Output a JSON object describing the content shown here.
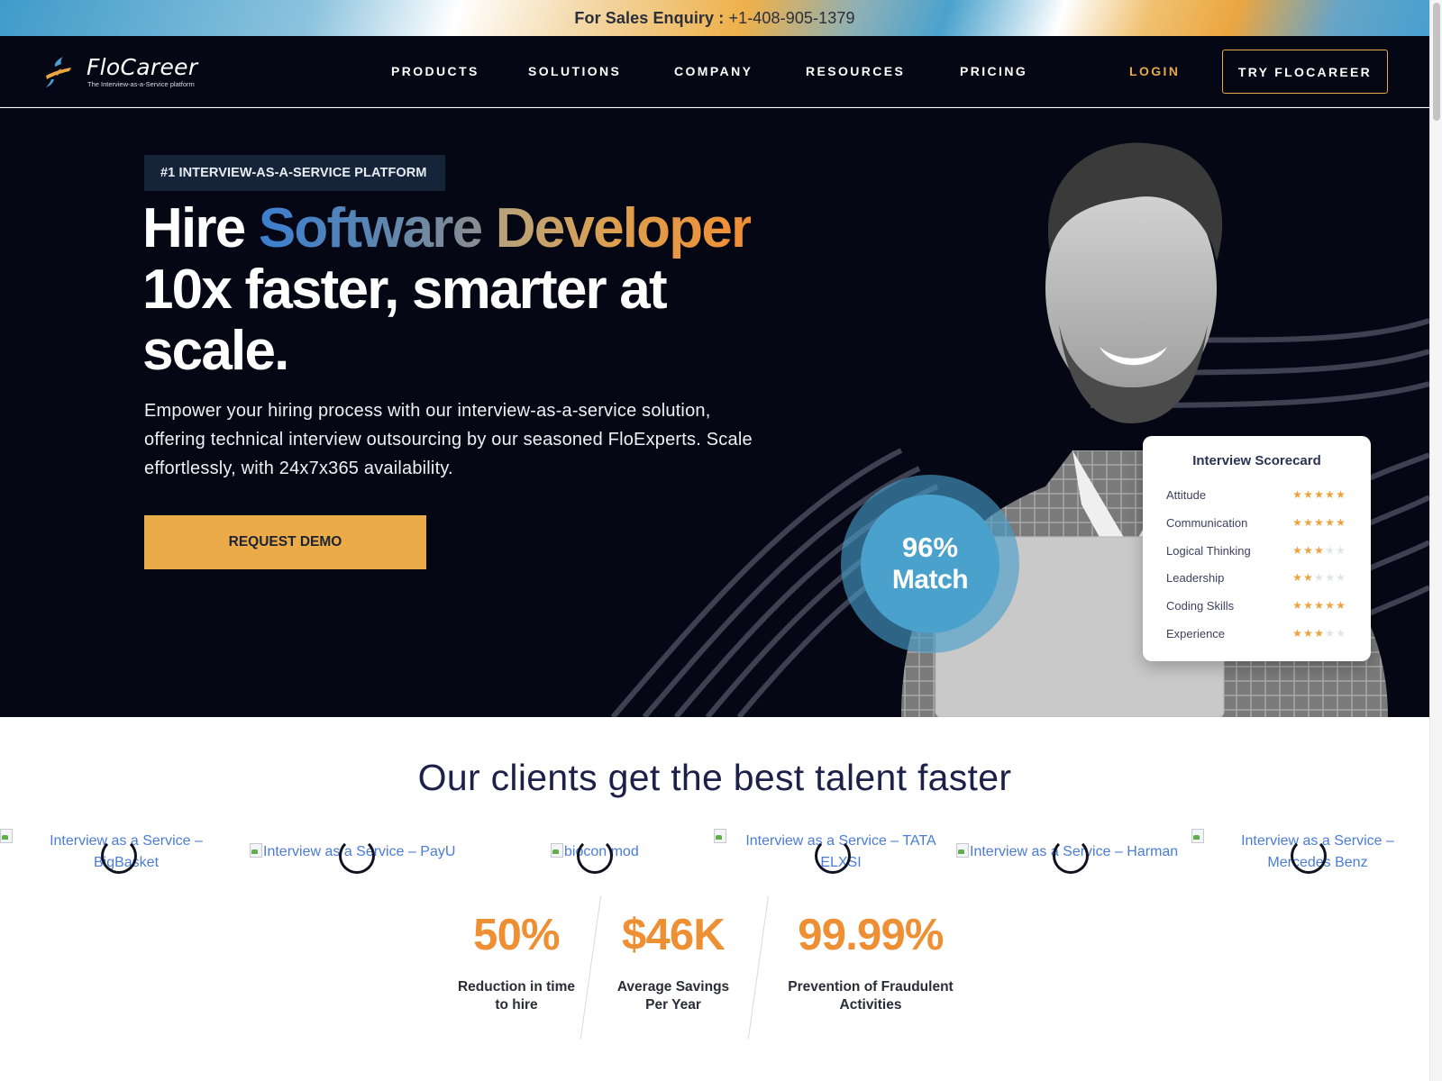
{
  "sales_bar": {
    "label": "For Sales Enquiry :",
    "phone": "+1-408-905-1379"
  },
  "nav": {
    "logo_text": "FloCareer",
    "logo_tagline": "The Interview-as-a-Service platform",
    "items": [
      {
        "label": "PRODUCTS"
      },
      {
        "label": "SOLUTIONS"
      },
      {
        "label": "COMPANY"
      },
      {
        "label": "RESOURCES"
      },
      {
        "label": "PRICING"
      }
    ],
    "login_label": "LOGIN",
    "cta_label": "TRY FLOCAREER",
    "accent_color": "#e7a94a"
  },
  "hero": {
    "badge": "#1 INTERVIEW-AS-A-SERVICE PLATFORM",
    "title_prefix": "Hire",
    "title_highlight_1": "Software",
    "title_highlight_2": "Developer",
    "title_rest": "10x faster, smarter at scale.",
    "description": "Empower your hiring process with our interview-as-a-service solution, offering technical interview outsourcing by our seasoned FloExperts. Scale effortlessly, with 24x7x365 availability.",
    "cta_label": "REQUEST DEMO",
    "match": {
      "value": "96%",
      "label": "Match"
    },
    "scorecard": {
      "title": "Interview Scorecard",
      "max_stars": 5,
      "rows": [
        {
          "label": "Attitude",
          "stars": 5
        },
        {
          "label": "Communication",
          "stars": 5
        },
        {
          "label": "Logical Thinking",
          "stars": 3
        },
        {
          "label": "Leadership",
          "stars": 2
        },
        {
          "label": "Coding Skills",
          "stars": 5
        },
        {
          "label": "Experience",
          "stars": 3
        }
      ]
    }
  },
  "clients": {
    "title": "Our clients get the best talent faster",
    "logos": [
      {
        "alt": "Interview as a Service – BigBasket"
      },
      {
        "alt": "Interview as a Service – PayU"
      },
      {
        "alt": "biocon mod"
      },
      {
        "alt": "Interview as a Service – TATA ELXSI"
      },
      {
        "alt": "Interview as a Service – Harman"
      },
      {
        "alt": "Interview as a Service – Mercedes Benz"
      }
    ]
  },
  "stats": [
    {
      "value": "50%",
      "label": "Reduction in time to hire"
    },
    {
      "value": "$46K",
      "label": "Average Savings Per Year"
    },
    {
      "value": "99.99%",
      "label": "Prevention of Fraudulent Activities"
    }
  ]
}
